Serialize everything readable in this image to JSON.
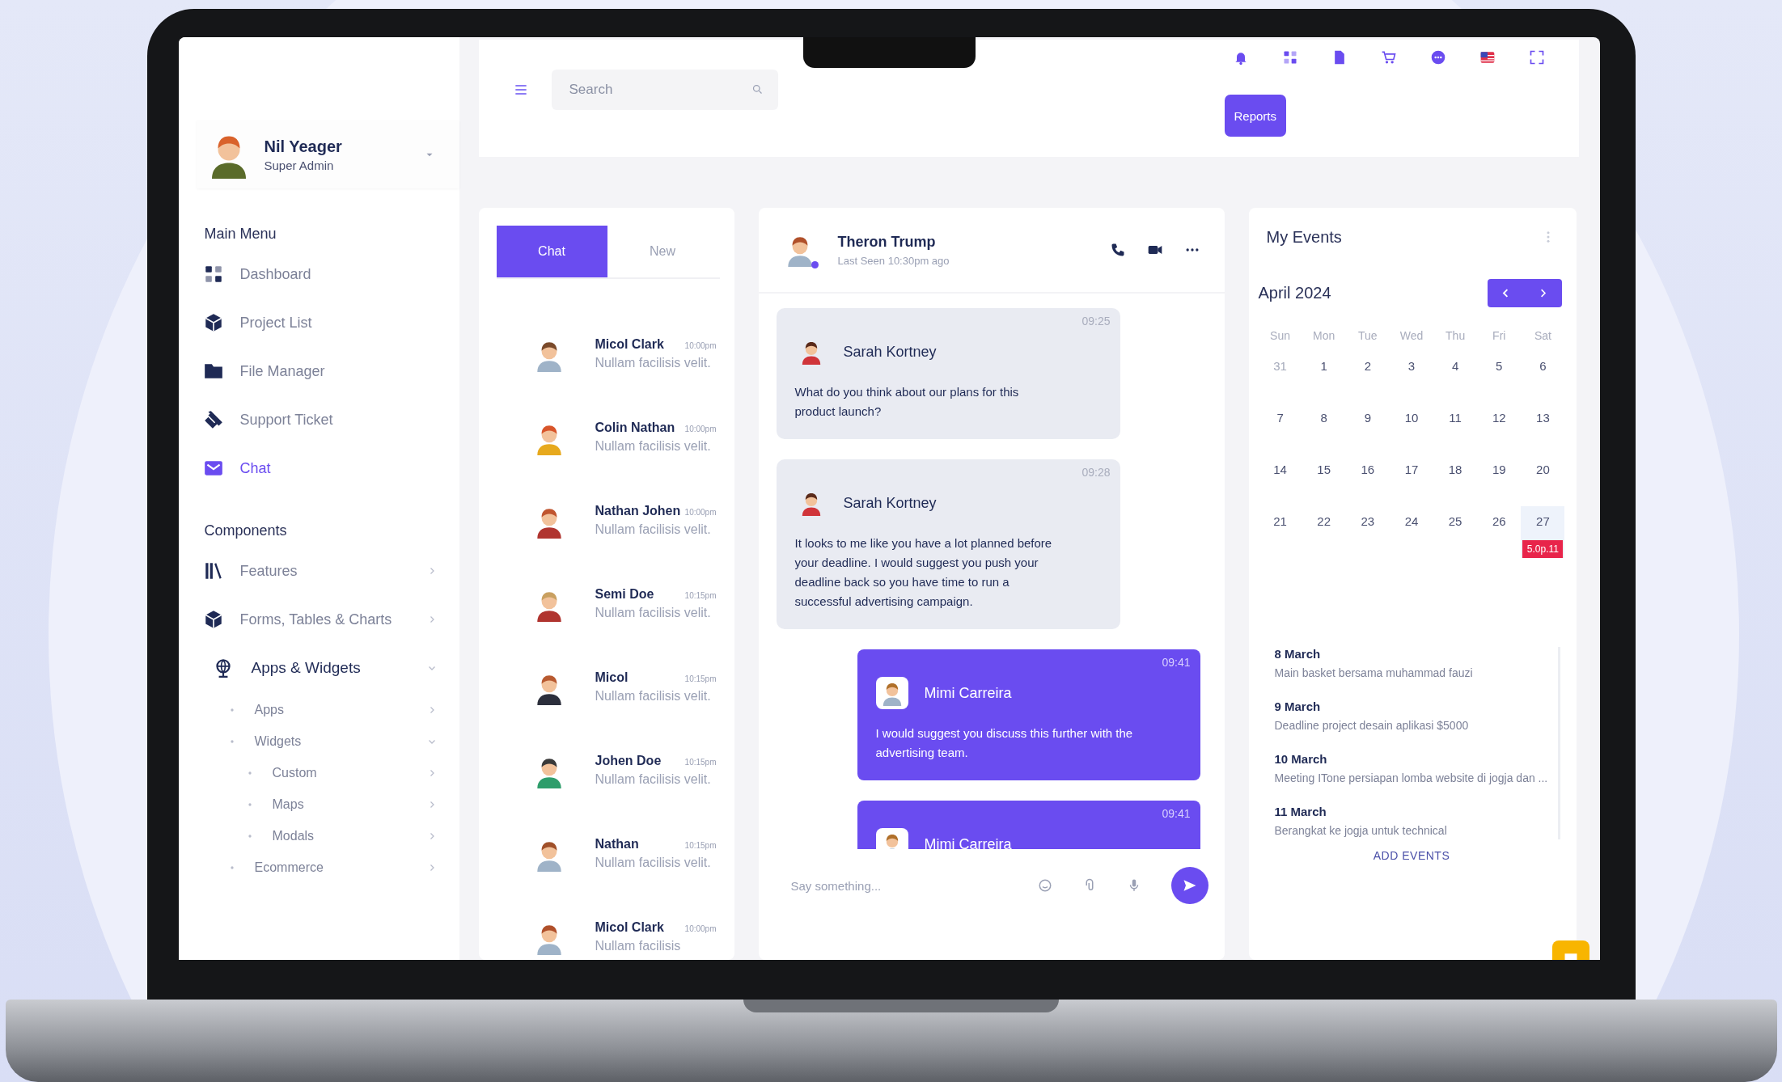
{
  "user": {
    "name": "Nil Yeager",
    "role": "Super Admin"
  },
  "sidebar": {
    "sections": [
      {
        "title": "Main Menu",
        "items": [
          {
            "label": "Dashboard",
            "selected": false
          },
          {
            "label": "Project List",
            "selected": false
          },
          {
            "label": "File Manager",
            "selected": false
          },
          {
            "label": "Support Ticket",
            "selected": false
          },
          {
            "label": "Chat",
            "selected": true
          }
        ]
      },
      {
        "title": "Components",
        "items": [
          {
            "label": "Features",
            "selected": false,
            "expanded": false
          },
          {
            "label": "Forms, Tables & Charts",
            "selected": false,
            "expanded": false
          },
          {
            "label": "Apps & Widgets",
            "selected": false,
            "expanded": true,
            "children": [
              {
                "label": "Apps",
                "expanded": false
              },
              {
                "label": "Widgets",
                "expanded": true,
                "children": [
                  {
                    "label": "Custom",
                    "expanded": false
                  },
                  {
                    "label": "Maps",
                    "expanded": false
                  },
                  {
                    "label": "Modals",
                    "expanded": false
                  }
                ]
              },
              {
                "label": "Ecommerce",
                "expanded": false
              }
            ]
          }
        ]
      }
    ]
  },
  "header": {
    "search": {
      "placeholder": "Search"
    },
    "button": "Reports"
  },
  "chat_list": {
    "tabs": [
      {
        "label": "Chat",
        "selected": true
      },
      {
        "label": "New",
        "selected": false
      }
    ],
    "contacts": [
      {
        "name": "Micol Clark",
        "time": "10:00pm",
        "preview": "Nullam facilisis velit."
      },
      {
        "name": "Colin Nathan",
        "time": "10:00pm",
        "preview": "Nullam facilisis velit."
      },
      {
        "name": "Nathan Johen",
        "time": "10:00pm",
        "preview": "Nullam facilisis velit."
      },
      {
        "name": "Semi Doe",
        "time": "10:15pm",
        "preview": "Nullam facilisis velit."
      },
      {
        "name": "Micol",
        "time": "10:15pm",
        "preview": "Nullam facilisis velit."
      },
      {
        "name": "Johen Doe",
        "time": "10:15pm",
        "preview": "Nullam facilisis velit."
      },
      {
        "name": "Nathan",
        "time": "10:15pm",
        "preview": "Nullam facilisis velit."
      },
      {
        "name": "Micol Clark",
        "time": "10:00pm",
        "preview": "Nullam facilisis"
      }
    ]
  },
  "conversation": {
    "name": "Theron Trump",
    "status": "Last Seen 10:30pm ago",
    "online": true,
    "messages": [
      {
        "sender": "Sarah Kortney",
        "time": "09:25",
        "text": "What do you think about our plans for this product launch?",
        "outgoing": false
      },
      {
        "sender": "Sarah Kortney",
        "time": "09:28",
        "text": "It looks to me like you have a lot planned before your deadline. I would suggest you push your deadline back so you have time to run a successful advertising campaign.",
        "outgoing": false
      },
      {
        "sender": "Mimi Carreira",
        "time": "09:41",
        "text": "I would suggest you discuss this further with the advertising team.",
        "outgoing": true
      },
      {
        "sender": "Mimi Carreira",
        "time": "09:41",
        "outgoing": true
      }
    ],
    "composer": {
      "placeholder": "Say something..."
    }
  },
  "events": {
    "title": "My Events",
    "month": "April 2024",
    "weekdays": [
      "Sun",
      "Mon",
      "Tue",
      "Wed",
      "Thu",
      "Fri",
      "Sat"
    ],
    "days": [
      {
        "label": "31",
        "muted": true
      },
      {
        "label": "1"
      },
      {
        "label": "2"
      },
      {
        "label": "3"
      },
      {
        "label": "4"
      },
      {
        "label": "5"
      },
      {
        "label": "6"
      },
      {
        "label": "7"
      },
      {
        "label": "8"
      },
      {
        "label": "9"
      },
      {
        "label": "10"
      },
      {
        "label": "11"
      },
      {
        "label": "12"
      },
      {
        "label": "13"
      },
      {
        "label": "14"
      },
      {
        "label": "15"
      },
      {
        "label": "16"
      },
      {
        "label": "17"
      },
      {
        "label": "18"
      },
      {
        "label": "19"
      },
      {
        "label": "20"
      },
      {
        "label": "21"
      },
      {
        "label": "22"
      },
      {
        "label": "23"
      },
      {
        "label": "24"
      },
      {
        "label": "25"
      },
      {
        "label": "26"
      },
      {
        "label": "27",
        "selected": true,
        "event": "5.0p.11"
      }
    ],
    "list": [
      {
        "date": "8 March",
        "text": "Main basket bersama muhammad fauzi"
      },
      {
        "date": "9 March",
        "text": "Deadline project desain aplikasi $5000"
      },
      {
        "date": "10 March",
        "text": "Meeting ITone persiapan lomba website di jogja dan ..."
      },
      {
        "date": "11 March",
        "text": "Berangkat ke jogja untuk technical"
      }
    ],
    "add": "ADD EVENTS"
  }
}
